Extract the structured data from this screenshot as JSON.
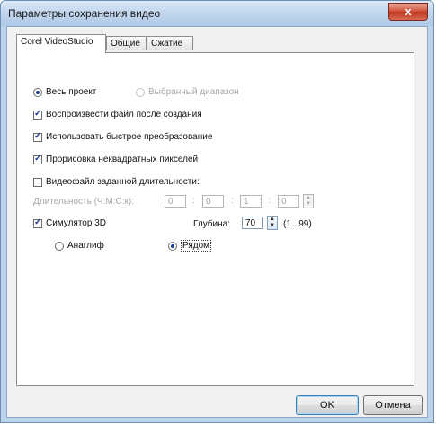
{
  "window": {
    "title": "Параметры сохранения видео",
    "close_label": "x"
  },
  "tabs": [
    {
      "label": "Corel VideoStudio",
      "active": true
    },
    {
      "label": "Общие",
      "active": false
    },
    {
      "label": "Сжатие",
      "active": false
    }
  ],
  "scope": {
    "whole_project": "Весь проект",
    "selected_range": "Выбранный диапазон",
    "selected": "whole_project"
  },
  "options": {
    "play_after_create": {
      "label": "Воспроизвести файл после создания",
      "checked": true
    },
    "fast_conversion": {
      "label": "Использовать быстрое преобразование",
      "checked": true
    },
    "non_square_pixels": {
      "label": "Прорисовка неквадратных пикселей",
      "checked": true
    },
    "fixed_duration": {
      "label": "Видеофайл заданной длительности:",
      "checked": false
    }
  },
  "duration": {
    "label": "Длительность (Ч:М:С:к):",
    "hours": "0",
    "minutes": "0",
    "seconds": "1",
    "frames": "0",
    "separator": ":"
  },
  "sim3d": {
    "label": "Симулятор 3D",
    "checked": true,
    "depth_label": "Глубина:",
    "depth_value": "70",
    "depth_range": "(1...99)",
    "anaglyph": "Анаглиф",
    "side_by_side": "Рядом",
    "selected": "side_by_side"
  },
  "buttons": {
    "ok": "OK",
    "cancel": "Отмена"
  },
  "icons": {
    "close": "close-icon",
    "spin": "spin-up-down-icon"
  }
}
